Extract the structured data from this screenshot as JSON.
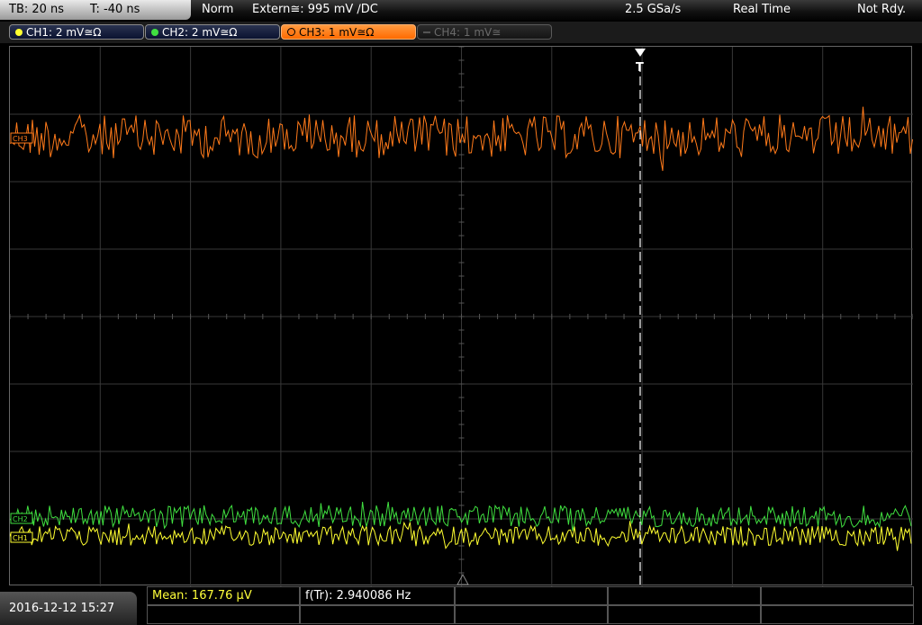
{
  "topbar": {
    "timebase": "TB: 20 ns",
    "trigger_time": "T: -40 ns",
    "mode": "Norm",
    "trigger_source": "Extern≅: 995 mV ∕DC",
    "sample_rate": "2.5 GSa/s",
    "acq_mode": "Real Time",
    "status": "Not Rdy."
  },
  "channels": [
    {
      "label": "CH1: 2 mV≅Ω",
      "color": "#ffff30",
      "state": "on"
    },
    {
      "label": "CH2: 2 mV≅Ω",
      "color": "#40e040",
      "state": "on"
    },
    {
      "label": "CH3: 1 mV≅Ω",
      "color": "#ff7a1a",
      "state": "active"
    },
    {
      "label": "CH4: 1 mV≅",
      "color": "#555555",
      "state": "off"
    }
  ],
  "markers": {
    "trigger": "T",
    "ch3_tag": "CH3",
    "ch2_tag": "CH2",
    "ch1_tag": "CH1"
  },
  "bottombar": {
    "datetime": "2016-12-12 15:27",
    "mean": "Mean: 167.76 µV",
    "freq": "f(Tr): 2.940086 Hz"
  },
  "colors": {
    "ch1": "#ffff30",
    "ch2": "#40e040",
    "ch3": "#ff7a1a",
    "grid": "#3a3a3a"
  }
}
